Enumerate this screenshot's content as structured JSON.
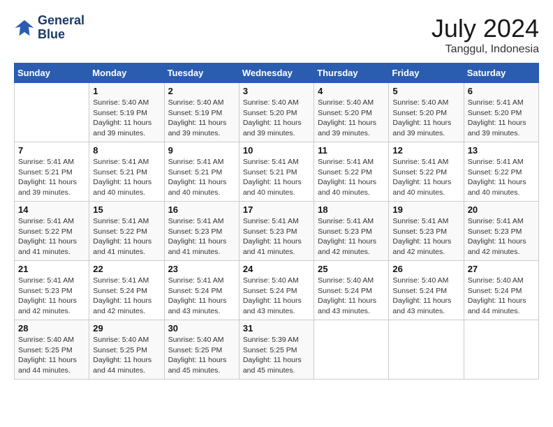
{
  "header": {
    "logo_line1": "General",
    "logo_line2": "Blue",
    "month_year": "July 2024",
    "location": "Tanggul, Indonesia"
  },
  "days_of_week": [
    "Sunday",
    "Monday",
    "Tuesday",
    "Wednesday",
    "Thursday",
    "Friday",
    "Saturday"
  ],
  "weeks": [
    [
      {
        "day": "",
        "info": ""
      },
      {
        "day": "1",
        "info": "Sunrise: 5:40 AM\nSunset: 5:19 PM\nDaylight: 11 hours\nand 39 minutes."
      },
      {
        "day": "2",
        "info": "Sunrise: 5:40 AM\nSunset: 5:19 PM\nDaylight: 11 hours\nand 39 minutes."
      },
      {
        "day": "3",
        "info": "Sunrise: 5:40 AM\nSunset: 5:20 PM\nDaylight: 11 hours\nand 39 minutes."
      },
      {
        "day": "4",
        "info": "Sunrise: 5:40 AM\nSunset: 5:20 PM\nDaylight: 11 hours\nand 39 minutes."
      },
      {
        "day": "5",
        "info": "Sunrise: 5:40 AM\nSunset: 5:20 PM\nDaylight: 11 hours\nand 39 minutes."
      },
      {
        "day": "6",
        "info": "Sunrise: 5:41 AM\nSunset: 5:20 PM\nDaylight: 11 hours\nand 39 minutes."
      }
    ],
    [
      {
        "day": "7",
        "info": "Sunrise: 5:41 AM\nSunset: 5:21 PM\nDaylight: 11 hours\nand 39 minutes."
      },
      {
        "day": "8",
        "info": "Sunrise: 5:41 AM\nSunset: 5:21 PM\nDaylight: 11 hours\nand 40 minutes."
      },
      {
        "day": "9",
        "info": "Sunrise: 5:41 AM\nSunset: 5:21 PM\nDaylight: 11 hours\nand 40 minutes."
      },
      {
        "day": "10",
        "info": "Sunrise: 5:41 AM\nSunset: 5:21 PM\nDaylight: 11 hours\nand 40 minutes."
      },
      {
        "day": "11",
        "info": "Sunrise: 5:41 AM\nSunset: 5:22 PM\nDaylight: 11 hours\nand 40 minutes."
      },
      {
        "day": "12",
        "info": "Sunrise: 5:41 AM\nSunset: 5:22 PM\nDaylight: 11 hours\nand 40 minutes."
      },
      {
        "day": "13",
        "info": "Sunrise: 5:41 AM\nSunset: 5:22 PM\nDaylight: 11 hours\nand 40 minutes."
      }
    ],
    [
      {
        "day": "14",
        "info": "Sunrise: 5:41 AM\nSunset: 5:22 PM\nDaylight: 11 hours\nand 41 minutes."
      },
      {
        "day": "15",
        "info": "Sunrise: 5:41 AM\nSunset: 5:22 PM\nDaylight: 11 hours\nand 41 minutes."
      },
      {
        "day": "16",
        "info": "Sunrise: 5:41 AM\nSunset: 5:23 PM\nDaylight: 11 hours\nand 41 minutes."
      },
      {
        "day": "17",
        "info": "Sunrise: 5:41 AM\nSunset: 5:23 PM\nDaylight: 11 hours\nand 41 minutes."
      },
      {
        "day": "18",
        "info": "Sunrise: 5:41 AM\nSunset: 5:23 PM\nDaylight: 11 hours\nand 42 minutes."
      },
      {
        "day": "19",
        "info": "Sunrise: 5:41 AM\nSunset: 5:23 PM\nDaylight: 11 hours\nand 42 minutes."
      },
      {
        "day": "20",
        "info": "Sunrise: 5:41 AM\nSunset: 5:23 PM\nDaylight: 11 hours\nand 42 minutes."
      }
    ],
    [
      {
        "day": "21",
        "info": "Sunrise: 5:41 AM\nSunset: 5:23 PM\nDaylight: 11 hours\nand 42 minutes."
      },
      {
        "day": "22",
        "info": "Sunrise: 5:41 AM\nSunset: 5:24 PM\nDaylight: 11 hours\nand 42 minutes."
      },
      {
        "day": "23",
        "info": "Sunrise: 5:41 AM\nSunset: 5:24 PM\nDaylight: 11 hours\nand 43 minutes."
      },
      {
        "day": "24",
        "info": "Sunrise: 5:40 AM\nSunset: 5:24 PM\nDaylight: 11 hours\nand 43 minutes."
      },
      {
        "day": "25",
        "info": "Sunrise: 5:40 AM\nSunset: 5:24 PM\nDaylight: 11 hours\nand 43 minutes."
      },
      {
        "day": "26",
        "info": "Sunrise: 5:40 AM\nSunset: 5:24 PM\nDaylight: 11 hours\nand 43 minutes."
      },
      {
        "day": "27",
        "info": "Sunrise: 5:40 AM\nSunset: 5:24 PM\nDaylight: 11 hours\nand 44 minutes."
      }
    ],
    [
      {
        "day": "28",
        "info": "Sunrise: 5:40 AM\nSunset: 5:25 PM\nDaylight: 11 hours\nand 44 minutes."
      },
      {
        "day": "29",
        "info": "Sunrise: 5:40 AM\nSunset: 5:25 PM\nDaylight: 11 hours\nand 44 minutes."
      },
      {
        "day": "30",
        "info": "Sunrise: 5:40 AM\nSunset: 5:25 PM\nDaylight: 11 hours\nand 45 minutes."
      },
      {
        "day": "31",
        "info": "Sunrise: 5:39 AM\nSunset: 5:25 PM\nDaylight: 11 hours\nand 45 minutes."
      },
      {
        "day": "",
        "info": ""
      },
      {
        "day": "",
        "info": ""
      },
      {
        "day": "",
        "info": ""
      }
    ]
  ]
}
